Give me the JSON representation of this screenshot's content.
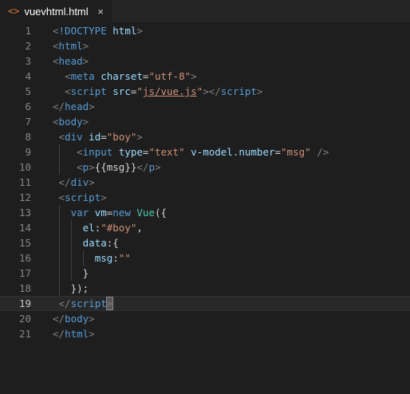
{
  "tab": {
    "filename": "vuevhtml.html",
    "file_icon": "<>",
    "close_glyph": "×"
  },
  "current_line": 19,
  "lines": [
    {
      "n": "1",
      "guides": [],
      "tokens": [
        [
          "t",
          "<"
        ],
        [
          "tn",
          "!DOCTYPE"
        ],
        [
          "p",
          " "
        ],
        [
          "an",
          "html"
        ],
        [
          "t",
          ">"
        ]
      ]
    },
    {
      "n": "2",
      "guides": [],
      "tokens": [
        [
          "t",
          "<"
        ],
        [
          "tn",
          "html"
        ],
        [
          "t",
          ">"
        ]
      ]
    },
    {
      "n": "3",
      "guides": [],
      "tokens": [
        [
          "t",
          "<"
        ],
        [
          "tn",
          "head"
        ],
        [
          "t",
          ">"
        ]
      ]
    },
    {
      "n": "4",
      "guides": [],
      "tokens": [
        [
          "p",
          "  "
        ],
        [
          "t",
          "<"
        ],
        [
          "tn",
          "meta"
        ],
        [
          "p",
          " "
        ],
        [
          "an",
          "charset"
        ],
        [
          "p",
          "="
        ],
        [
          "s",
          "\"utf-8\""
        ],
        [
          "t",
          ">"
        ]
      ]
    },
    {
      "n": "5",
      "guides": [],
      "tokens": [
        [
          "p",
          "  "
        ],
        [
          "t",
          "<"
        ],
        [
          "tn",
          "script"
        ],
        [
          "p",
          " "
        ],
        [
          "an",
          "src"
        ],
        [
          "p",
          "="
        ],
        [
          "s",
          "\""
        ],
        [
          "su",
          "js/vue.js"
        ],
        [
          "s",
          "\""
        ],
        [
          "t",
          "></"
        ],
        [
          "tn",
          "script"
        ],
        [
          "t",
          ">"
        ]
      ]
    },
    {
      "n": "6",
      "guides": [],
      "tokens": [
        [
          "t",
          "</"
        ],
        [
          "tn",
          "head"
        ],
        [
          "t",
          ">"
        ]
      ]
    },
    {
      "n": "7",
      "guides": [],
      "tokens": [
        [
          "t",
          "<"
        ],
        [
          "tn",
          "body"
        ],
        [
          "t",
          ">"
        ]
      ]
    },
    {
      "n": "8",
      "guides": [],
      "tokens": [
        [
          "p",
          " "
        ],
        [
          "t",
          "<"
        ],
        [
          "tn",
          "div"
        ],
        [
          "p",
          " "
        ],
        [
          "an",
          "id"
        ],
        [
          "p",
          "="
        ],
        [
          "s",
          "\"boy\""
        ],
        [
          "t",
          ">"
        ]
      ]
    },
    {
      "n": "9",
      "guides": [
        8
      ],
      "tokens": [
        [
          "p",
          "    "
        ],
        [
          "t",
          "<"
        ],
        [
          "tn",
          "input"
        ],
        [
          "p",
          " "
        ],
        [
          "an",
          "type"
        ],
        [
          "p",
          "="
        ],
        [
          "s",
          "\"text\""
        ],
        [
          "p",
          " "
        ],
        [
          "an",
          "v-model.number"
        ],
        [
          "p",
          "="
        ],
        [
          "s",
          "\"msg\""
        ],
        [
          "p",
          " "
        ],
        [
          "t",
          "/>"
        ]
      ]
    },
    {
      "n": "10",
      "guides": [
        8
      ],
      "tokens": [
        [
          "p",
          "    "
        ],
        [
          "t",
          "<"
        ],
        [
          "tn",
          "p"
        ],
        [
          "t",
          ">"
        ],
        [
          "p",
          "{{msg}}"
        ],
        [
          "t",
          "</"
        ],
        [
          "tn",
          "p"
        ],
        [
          "t",
          ">"
        ]
      ]
    },
    {
      "n": "11",
      "guides": [],
      "tokens": [
        [
          "p",
          " "
        ],
        [
          "t",
          "</"
        ],
        [
          "tn",
          "div"
        ],
        [
          "t",
          ">"
        ]
      ]
    },
    {
      "n": "12",
      "guides": [],
      "tokens": [
        [
          "p",
          " "
        ],
        [
          "t",
          "<"
        ],
        [
          "tn",
          "script"
        ],
        [
          "t",
          ">"
        ]
      ]
    },
    {
      "n": "13",
      "guides": [
        8
      ],
      "tokens": [
        [
          "p",
          "   "
        ],
        [
          "kw",
          "var"
        ],
        [
          "p",
          " "
        ],
        [
          "an",
          "vm"
        ],
        [
          "p",
          "="
        ],
        [
          "kw",
          "new"
        ],
        [
          "p",
          " "
        ],
        [
          "cls",
          "Vue"
        ],
        [
          "p",
          "({"
        ]
      ]
    },
    {
      "n": "14",
      "guides": [
        8,
        23
      ],
      "tokens": [
        [
          "p",
          "     "
        ],
        [
          "an",
          "el"
        ],
        [
          "p",
          ":"
        ],
        [
          "s",
          "\"#boy\""
        ],
        [
          "p",
          ","
        ]
      ]
    },
    {
      "n": "15",
      "guides": [
        8,
        23
      ],
      "tokens": [
        [
          "p",
          "     "
        ],
        [
          "an",
          "data"
        ],
        [
          "p",
          ":{"
        ]
      ]
    },
    {
      "n": "16",
      "guides": [
        8,
        23,
        38
      ],
      "tokens": [
        [
          "p",
          "       "
        ],
        [
          "an",
          "msg"
        ],
        [
          "p",
          ":"
        ],
        [
          "s",
          "\"\""
        ]
      ]
    },
    {
      "n": "17",
      "guides": [
        8,
        23
      ],
      "tokens": [
        [
          "p",
          "     "
        ],
        [
          "p",
          "}"
        ]
      ]
    },
    {
      "n": "18",
      "guides": [
        8
      ],
      "tokens": [
        [
          "p",
          "   "
        ],
        [
          "p",
          "});"
        ]
      ]
    },
    {
      "n": "19",
      "guides": [],
      "tokens": [
        [
          "p",
          " "
        ],
        [
          "t",
          "</"
        ],
        [
          "tn",
          "script"
        ],
        [
          "tb",
          ">"
        ]
      ]
    },
    {
      "n": "20",
      "guides": [],
      "tokens": [
        [
          "t",
          "</"
        ],
        [
          "tn",
          "body"
        ],
        [
          "t",
          ">"
        ]
      ]
    },
    {
      "n": "21",
      "guides": [],
      "tokens": [
        [
          "t",
          "</"
        ],
        [
          "tn",
          "html"
        ],
        [
          "t",
          ">"
        ]
      ]
    }
  ]
}
